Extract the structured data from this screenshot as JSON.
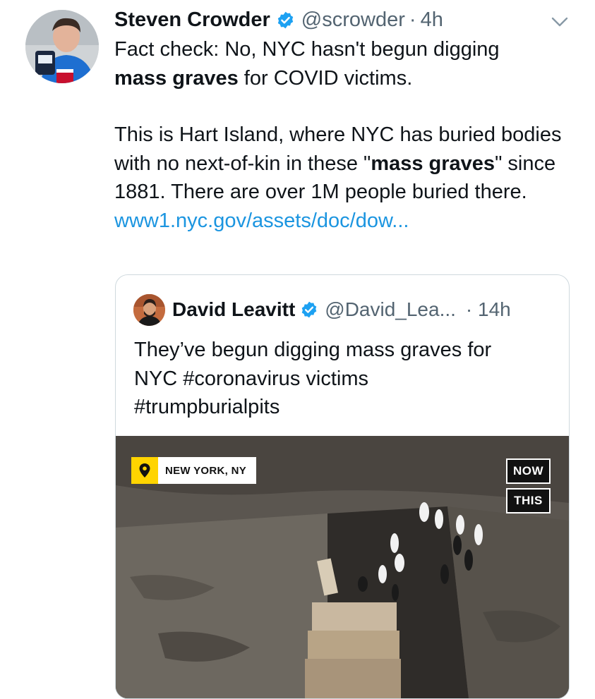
{
  "tweet": {
    "author_name": "Steven Crowder",
    "handle": "@scrowder",
    "separator": "·",
    "time": "4h",
    "text_line1_prefix": "Fact check: No, NYC hasn't begun digging",
    "text_line2_bold": "mass graves",
    "text_line2_suffix": " for COVID victims.",
    "para2_part1": "This is Hart Island, where NYC has buried bodies with no next-of-kin in these \"",
    "para2_bold": "mass graves",
    "para2_part2": "\" since 1881. There are over 1M people buried there.",
    "link": "www1.nyc.gov/assets/doc/dow..."
  },
  "quoted_tweet": {
    "author_name": "David Leavitt",
    "handle": "@David_Lea...",
    "time": "· 14h",
    "text_line1": "They’ve begun digging mass graves for",
    "text_line2": "NYC #coronavirus victims",
    "text_line3": "#trumpburialpits",
    "media": {
      "location_label": "NEW YORK, NY",
      "watermark_top": "NOW",
      "watermark_bottom": "THIS"
    }
  },
  "colors": {
    "verified": "#1da1f2",
    "link": "#1b95e0",
    "secondary_text": "#536471",
    "location_pin_bg": "#ffd400"
  },
  "icons": [
    "verified-badge-icon",
    "chevron-down-icon",
    "location-pin-icon"
  ]
}
